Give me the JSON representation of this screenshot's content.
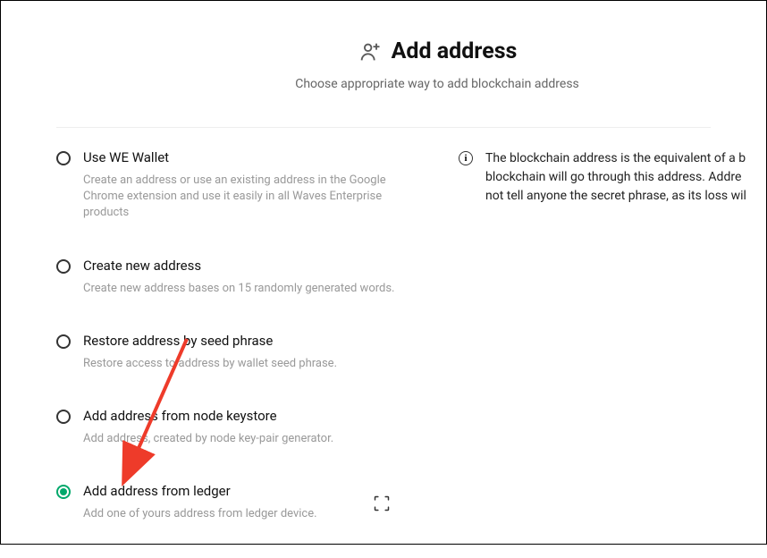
{
  "header": {
    "title": "Add address",
    "subtitle": "Choose appropriate way to add blockchain address"
  },
  "options": [
    {
      "label": "Use WE Wallet",
      "desc": "Create an address or use an existing address in the Google Chrome extension and use it easily in all Waves Enterprise products"
    },
    {
      "label": "Create new address",
      "desc": "Create new address bases on 15 randomly generated words."
    },
    {
      "label": "Restore address by seed phrase",
      "desc": "Restore access to address by wallet seed phrase."
    },
    {
      "label": "Add address from node keystore",
      "desc": "Add address, created by node key-pair generator."
    },
    {
      "label": "Add address from ledger",
      "desc": "Add one of yours address from ledger device."
    }
  ],
  "info": {
    "line1": "The blockchain address is the equivalent of a b",
    "line2": "blockchain will go through this address. Addre",
    "line3": "not tell anyone the secret phrase, as its loss wil"
  }
}
